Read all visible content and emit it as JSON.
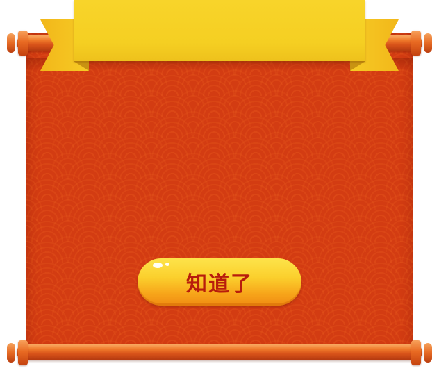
{
  "dialog": {
    "confirm_label": "知道了"
  },
  "colors": {
    "panel": "#d33c12",
    "ribbon": "#f5cf22",
    "roller": "#e96a22",
    "button_top": "#fde34a",
    "button_bottom": "#f08b12",
    "button_text": "#b81c0c"
  },
  "icons": {
    "ribbon": "ribbon-banner",
    "rollers": "scroll-roller"
  }
}
